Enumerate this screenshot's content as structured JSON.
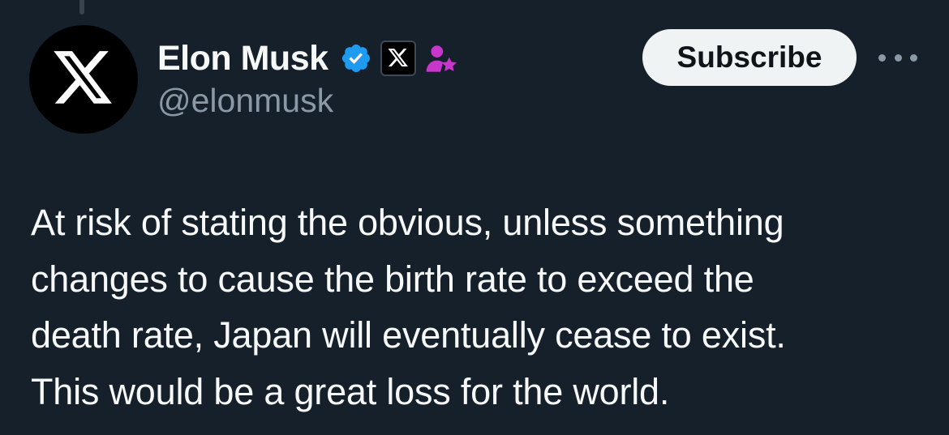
{
  "tweet": {
    "author": {
      "display_name": "Elon Musk",
      "handle": "@elonmusk",
      "avatar_icon": "x-logo-icon",
      "badges": [
        "verified-badge-icon",
        "x-affiliate-badge-icon",
        "subscriber-badge-icon"
      ]
    },
    "subscribe_label": "Subscribe",
    "more_icon": "more-options-icon",
    "text": "At risk of stating the obvious, unless something\nchanges to cause the birth rate to exceed the\ndeath rate, Japan will eventually cease to exist.\nThis would be a great loss for the world."
  },
  "colors": {
    "background": "#15202b",
    "verified_blue": "#1d9bf0",
    "subscriber_purple": "#c936cc",
    "handle_gray": "#8b98a5",
    "button_bg": "#eff3f4"
  }
}
